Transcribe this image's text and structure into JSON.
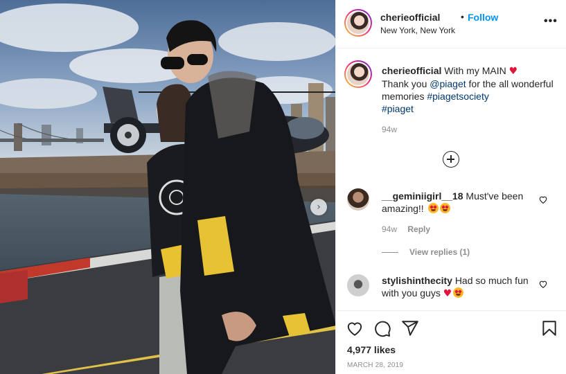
{
  "post": {
    "username": "cherieofficial",
    "separator": "•",
    "follow_label": "Follow",
    "location": "New York, New York",
    "more_label": "•••"
  },
  "caption": {
    "username": "cherieofficial",
    "text_1": "With my MAIN",
    "heart": "♥",
    "text_2": "Thank you",
    "mention": "@piaget",
    "text_3": "for the all wonderful memories",
    "hashtag_1": "#piagetsociety",
    "hashtag_2": "#piaget",
    "time": "94w"
  },
  "comments": [
    {
      "username": "__geminiigirl__18",
      "text": "Must've been amazing!!",
      "emoji_count": 2,
      "time": "94w",
      "reply_label": "Reply",
      "view_replies": "View replies (1)"
    },
    {
      "username": "stylishinthecity",
      "text": "Had so much fun with you guys",
      "heart": "♥"
    }
  ],
  "actions": {
    "likes": "4,977 likes",
    "date": "MARCH 28, 2019"
  },
  "icons": {
    "next": "chevron-right-icon",
    "more": "more-options-icon",
    "load_more": "add-circle-icon",
    "like": "heart-icon",
    "comment": "comment-icon",
    "share": "paper-plane-icon",
    "save": "bookmark-icon"
  },
  "colors": {
    "follow": "#0095f6",
    "link": "#00376b",
    "muted": "#8e8e8e",
    "heart": "#e0143c"
  }
}
